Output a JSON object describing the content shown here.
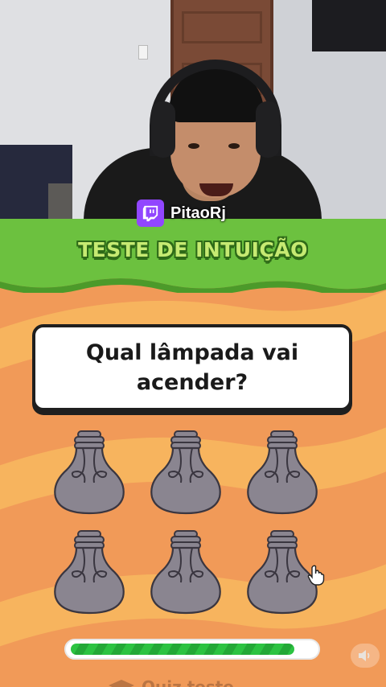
{
  "stream": {
    "platform_icon": "twitch-icon",
    "channel_name": "PitaoRj"
  },
  "quiz": {
    "title": "TESTE DE INTUIÇÃO",
    "question": "Qual lâmpada vai acender?",
    "options": [
      {
        "icon": "lightbulb-icon",
        "state": "off"
      },
      {
        "icon": "lightbulb-icon",
        "state": "off"
      },
      {
        "icon": "lightbulb-icon",
        "state": "off"
      },
      {
        "icon": "lightbulb-icon",
        "state": "off"
      },
      {
        "icon": "lightbulb-icon",
        "state": "off"
      },
      {
        "icon": "lightbulb-icon",
        "state": "off"
      }
    ],
    "progress_fraction": 0.92,
    "sound_icon": "speaker-icon",
    "brand_icon": "graduation-cap-icon",
    "brand_text": "Quiz teste"
  },
  "colors": {
    "header_green": "#6cc13f",
    "title_fill": "#c6ea72",
    "title_outline": "#2e6a18",
    "background_orange": "#f19a58",
    "stripe_light": "#f7b45e",
    "bulb_gray": "#8a8590",
    "progress_green": "#2cc341",
    "twitch_purple": "#9146ff"
  }
}
